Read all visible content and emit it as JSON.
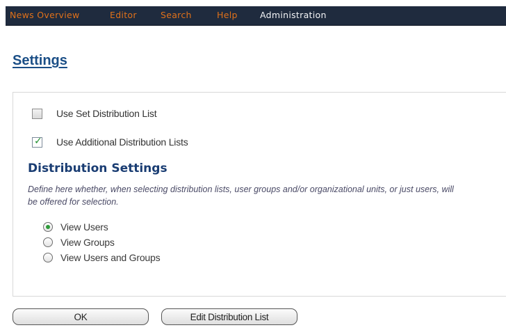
{
  "menu": {
    "items": [
      {
        "label": "News Overview"
      },
      {
        "label": "Editor"
      },
      {
        "label": "Search"
      },
      {
        "label": "Help"
      },
      {
        "label": "Administration"
      }
    ],
    "active": "Administration"
  },
  "page": {
    "title": "Settings"
  },
  "options": {
    "set_list": {
      "label": "Use Set Distribution List",
      "checked": false
    },
    "additional_lists": {
      "label": "Use Additional Distribution Lists",
      "checked": true
    }
  },
  "distribution": {
    "heading": "Distribution Settings",
    "description": "Define here whether, when selecting distribution lists, user groups and/or organizational units, or just users, will be offered for selection.",
    "choices": [
      {
        "label": "View Users",
        "selected": true
      },
      {
        "label": "View Groups",
        "selected": false
      },
      {
        "label": "View Users and Groups",
        "selected": false
      }
    ]
  },
  "buttons": {
    "ok": "OK",
    "edit_list": "Edit Distribution List"
  },
  "colors": {
    "menubar_bg": "#1f2b3e",
    "menu_link": "#e0711a",
    "menu_active": "#f3f4f6",
    "title": "#1a4e86",
    "heading": "#1a3d73",
    "check_green": "#1f8f2e"
  }
}
